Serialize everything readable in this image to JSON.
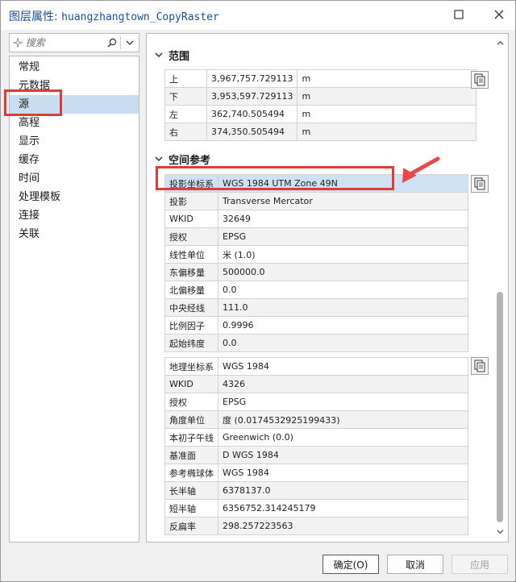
{
  "window": {
    "title_prefix": "图层属性: ",
    "title_layer": "huangzhangtown_CopyRaster"
  },
  "search": {
    "placeholder": "搜索"
  },
  "nav": {
    "items": [
      "常规",
      "元数据",
      "源",
      "高程",
      "显示",
      "缓存",
      "时间",
      "处理模板",
      "连接",
      "关联"
    ],
    "selected": "源"
  },
  "extent": {
    "title": "范围",
    "rows": [
      {
        "label": "上",
        "value": "3,967,757.729113",
        "unit": "m"
      },
      {
        "label": "下",
        "value": "3,953,597.729113",
        "unit": "m"
      },
      {
        "label": "左",
        "value": "362,740.505494",
        "unit": "m"
      },
      {
        "label": "右",
        "value": "374,350.505494",
        "unit": "m"
      }
    ]
  },
  "spatial_reference": {
    "title": "空间参考",
    "projected": [
      {
        "label": "投影坐标系",
        "value": "WGS 1984 UTM Zone 49N"
      },
      {
        "label": "投影",
        "value": "Transverse Mercator"
      },
      {
        "label": "WKID",
        "value": "32649"
      },
      {
        "label": "授权",
        "value": "EPSG"
      },
      {
        "label": "线性单位",
        "value": "米 (1.0)"
      },
      {
        "label": "东偏移量",
        "value": "500000.0"
      },
      {
        "label": "北偏移量",
        "value": "0.0"
      },
      {
        "label": "中央经线",
        "value": "111.0"
      },
      {
        "label": "比例因子",
        "value": "0.9996"
      },
      {
        "label": "起始纬度",
        "value": "0.0"
      }
    ],
    "geographic": [
      {
        "label": "地理坐标系",
        "value": "WGS 1984"
      },
      {
        "label": "WKID",
        "value": "4326"
      },
      {
        "label": "授权",
        "value": "EPSG"
      },
      {
        "label": "角度单位",
        "value": "度 (0.0174532925199433)"
      },
      {
        "label": "本初子午线",
        "value": "Greenwich (0.0)"
      },
      {
        "label": "基准面",
        "value": "D WGS 1984"
      },
      {
        "label": "参考椭球体",
        "value": "WGS 1984"
      },
      {
        "label": "长半轴",
        "value": "6378137.0"
      },
      {
        "label": "短半轴",
        "value": "6356752.314245179"
      },
      {
        "label": "反扁率",
        "value": "298.257223563"
      }
    ]
  },
  "buttons": {
    "ok": "确定(O)",
    "cancel": "取消",
    "apply": "应用"
  },
  "annotations": {
    "highlight_color": "#e03a3a",
    "selection_color": "#c9def0"
  }
}
